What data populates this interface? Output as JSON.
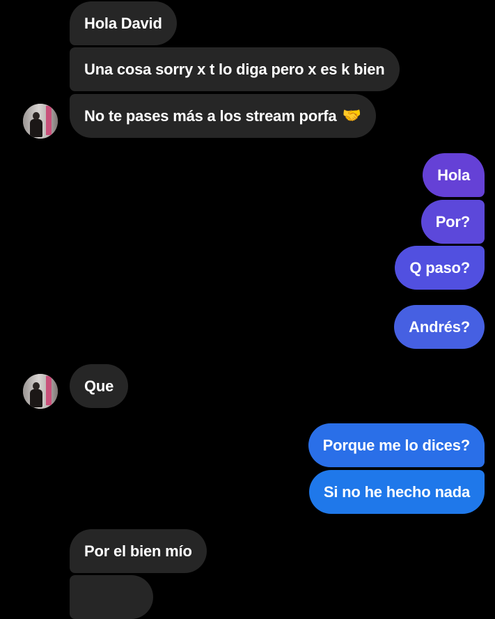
{
  "messages": [
    {
      "text": "Hola David"
    },
    {
      "text": "Una cosa sorry x t lo diga pero x es k bien"
    },
    {
      "text": "No te pases más a los stream porfa",
      "emoji": "🤝"
    },
    {
      "text": "Hola"
    },
    {
      "text": "Por?"
    },
    {
      "text": "Q paso?"
    },
    {
      "text": "Andrés?"
    },
    {
      "text": "Que"
    },
    {
      "text": "Porque me lo dices?"
    },
    {
      "text": "Si no he hecho nada"
    },
    {
      "text": "Por el bien mío"
    }
  ],
  "colors": {
    "incoming_bubble": "#262626",
    "outgoing_gradient_top": "#6a3fd2",
    "outgoing_gradient_bottom": "#1f78ea",
    "background": "#000000",
    "text": "#ffffff"
  },
  "icons": {
    "avatar": "contact-avatar-photo",
    "handshake": "handshake-emoji"
  }
}
